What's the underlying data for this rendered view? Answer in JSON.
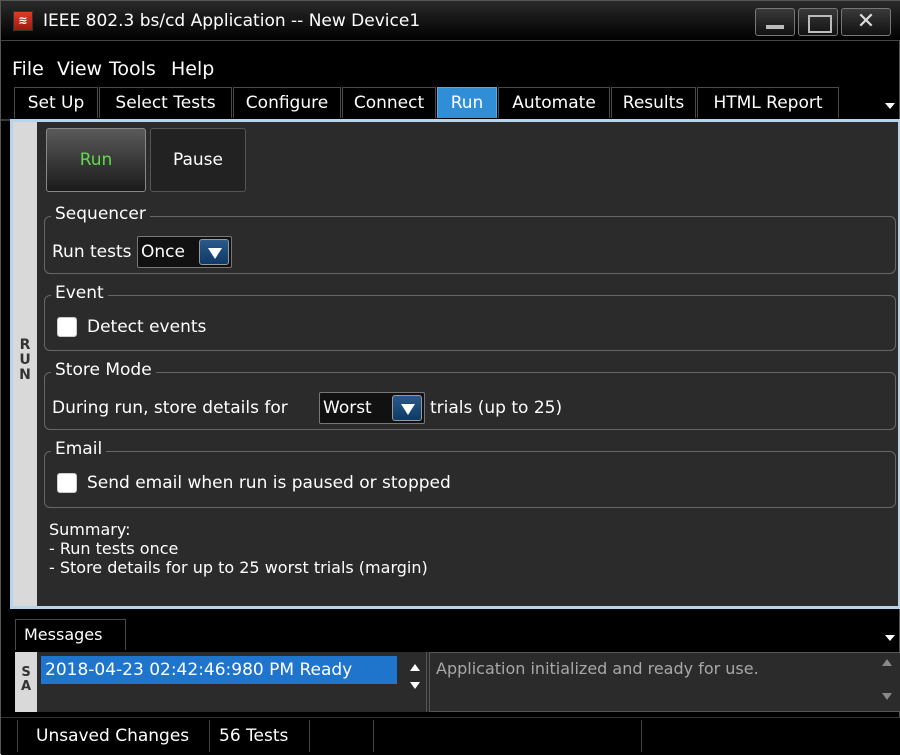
{
  "window": {
    "title": "IEEE 802.3 bs/cd Application -- New Device1"
  },
  "menu": [
    "File",
    "View",
    "Tools",
    "Help"
  ],
  "tabs": [
    {
      "label": "Set Up"
    },
    {
      "label": "Select Tests"
    },
    {
      "label": "Configure"
    },
    {
      "label": "Connect"
    },
    {
      "label": "Run",
      "active": true
    },
    {
      "label": "Automate"
    },
    {
      "label": "Results"
    },
    {
      "label": "HTML Report"
    }
  ],
  "side_label": "R U N",
  "buttons": {
    "run": "Run",
    "pause": "Pause"
  },
  "sequencer": {
    "title": "Sequencer",
    "label": "Run tests",
    "value": "Once"
  },
  "event": {
    "title": "Event",
    "checkbox_label": "Detect events",
    "checked": false
  },
  "store_mode": {
    "title": "Store Mode",
    "label_before": "During run, store details for",
    "value": "Worst",
    "label_after": "trials (up to 25)"
  },
  "email": {
    "title": "Email",
    "checkbox_label": "Send email when run is paused or stopped",
    "checked": false
  },
  "summary": {
    "heading": "Summary:",
    "lines": [
      "- Run tests once",
      "- Store details for up to 25 worst trials (margin)"
    ]
  },
  "messages": {
    "tab_label": "Messages",
    "side_label": "S A",
    "selected_entry": "2018-04-23 02:42:46:980 PM Ready",
    "detail": "Application initialized and ready for use."
  },
  "status": {
    "unsaved": "Unsaved Changes",
    "tests": "56 Tests"
  },
  "colors": {
    "accent": "#2f8ed6",
    "run_text": "#5edc4a",
    "panel_border": "#b8d4ea",
    "selection": "#1f74cc"
  }
}
